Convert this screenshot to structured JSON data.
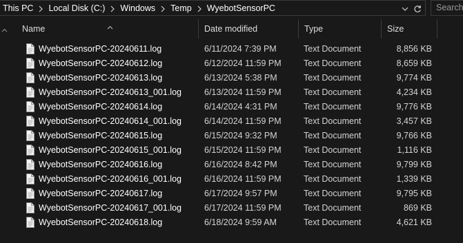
{
  "address_bar": {
    "crumbs": [
      "This PC",
      "Local Disk (C:)",
      "Windows",
      "Temp",
      "WyebotSensorPC"
    ],
    "icons": [
      "chevron-right-icon",
      "chevron-down-icon",
      "refresh-icon"
    ]
  },
  "search": {
    "placeholder": "Search"
  },
  "columns": {
    "name": "Name",
    "date": "Date modified",
    "type": "Type",
    "size": "Size"
  },
  "files": [
    {
      "name": "WyebotSensorPC-20240611.log",
      "date": "6/11/2024 7:39 PM",
      "type": "Text Document",
      "size": "8,856 KB"
    },
    {
      "name": "WyebotSensorPC-20240612.log",
      "date": "6/12/2024 11:59 PM",
      "type": "Text Document",
      "size": "8,659 KB"
    },
    {
      "name": "WyebotSensorPC-20240613.log",
      "date": "6/13/2024 5:38 PM",
      "type": "Text Document",
      "size": "9,774 KB"
    },
    {
      "name": "WyebotSensorPC-20240613_001.log",
      "date": "6/13/2024 11:59 PM",
      "type": "Text Document",
      "size": "4,234 KB"
    },
    {
      "name": "WyebotSensorPC-20240614.log",
      "date": "6/14/2024 4:31 PM",
      "type": "Text Document",
      "size": "9,776 KB"
    },
    {
      "name": "WyebotSensorPC-20240614_001.log",
      "date": "6/14/2024 11:59 PM",
      "type": "Text Document",
      "size": "3,457 KB"
    },
    {
      "name": "WyebotSensorPC-20240615.log",
      "date": "6/15/2024 9:32 PM",
      "type": "Text Document",
      "size": "9,766 KB"
    },
    {
      "name": "WyebotSensorPC-20240615_001.log",
      "date": "6/15/2024 11:59 PM",
      "type": "Text Document",
      "size": "1,116 KB"
    },
    {
      "name": "WyebotSensorPC-20240616.log",
      "date": "6/16/2024 8:42 PM",
      "type": "Text Document",
      "size": "9,799 KB"
    },
    {
      "name": "WyebotSensorPC-20240616_001.log",
      "date": "6/16/2024 11:59 PM",
      "type": "Text Document",
      "size": "1,339 KB"
    },
    {
      "name": "WyebotSensorPC-20240617.log",
      "date": "6/17/2024 9:57 PM",
      "type": "Text Document",
      "size": "9,795 KB"
    },
    {
      "name": "WyebotSensorPC-20240617_001.log",
      "date": "6/17/2024 11:59 PM",
      "type": "Text Document",
      "size": "869 KB"
    },
    {
      "name": "WyebotSensorPC-20240618.log",
      "date": "6/18/2024 9:59 AM",
      "type": "Text Document",
      "size": "4,621 KB"
    }
  ],
  "file_icon": "text-document-icon",
  "colors": {
    "background": "#191919",
    "text": "#ffffff",
    "border": "#3a3a3a"
  }
}
